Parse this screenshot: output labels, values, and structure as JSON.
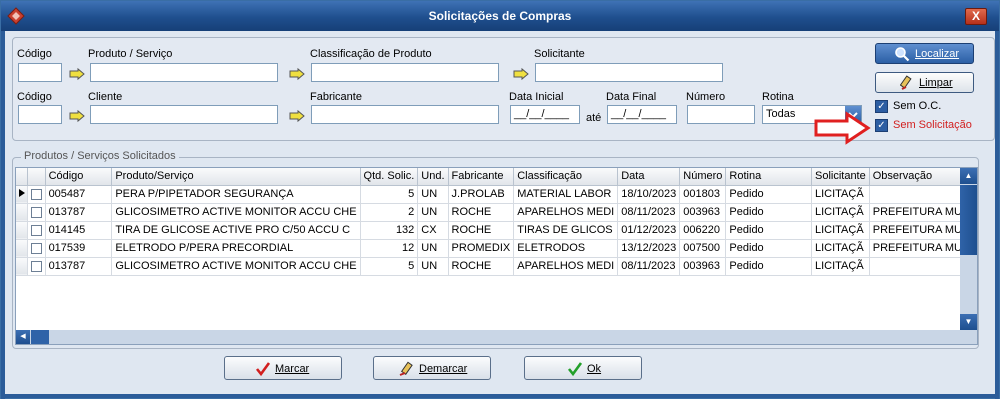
{
  "window": {
    "title": "Solicitações de Compras",
    "close_label": "X"
  },
  "filters": {
    "codigo1_label": "Código",
    "produto_label": "Produto / Serviço",
    "classificacao_label": "Classificação de Produto",
    "solicitante_label": "Solicitante",
    "codigo2_label": "Código",
    "cliente_label": "Cliente",
    "fabricante_label": "Fabricante",
    "data_inicial_label": "Data Inicial",
    "data_final_label": "Data Final",
    "ate_label": "até",
    "numero_label": "Número",
    "rotina_label": "Rotina",
    "data_inicial_value": "__/__/____",
    "data_final_value": "__/__/____",
    "rotina_value": "Todas",
    "localizar_label": "Localizar",
    "limpar_label": "Limpar",
    "sem_oc_label": "Sem O.C.",
    "sem_solicitacao_label": "Sem Solicitação",
    "sem_oc_checked": true,
    "sem_solicitacao_checked": true
  },
  "products": {
    "title": "Produtos / Serviços Solicitados",
    "columns": [
      "Código",
      "Produto/Serviço",
      "Qtd. Solic.",
      "Und.",
      "Fabricante",
      "Classificação",
      "Data",
      "Número",
      "Rotina",
      "Solicitante",
      "Observação"
    ],
    "rows": [
      [
        "005487",
        "PERA P/PIPETADOR SEGURANÇA",
        "5",
        "UN",
        "J.PROLAB",
        "MATERIAL LABOR",
        "18/10/2023",
        "001803",
        "Pedido",
        "LICITAÇÃ",
        ""
      ],
      [
        "013787",
        "GLICOSIMETRO ACTIVE MONITOR  ACCU CHE",
        "2",
        "UN",
        "ROCHE",
        "APARELHOS MEDI",
        "08/11/2023",
        "003963",
        "Pedido",
        "LICITAÇÃ",
        "PREFEITURA MUNI"
      ],
      [
        "014145",
        "TIRA DE GLICOSE ACTIVE PRO C/50  ACCU C",
        "132",
        "CX",
        "ROCHE",
        "TIRAS DE GLICOS",
        "01/12/2023",
        "006220",
        "Pedido",
        "LICITAÇÃ",
        "PREFEITURA MUNI"
      ],
      [
        "017539",
        "ELETRODO P/PERA PRECORDIAL",
        "12",
        "UN",
        "PROMEDIX",
        "ELETRODOS",
        "13/12/2023",
        "007500",
        "Pedido",
        "LICITAÇÃ",
        "PREFEITURA MUNI"
      ],
      [
        "013787",
        "GLICOSIMETRO ACTIVE MONITOR  ACCU CHE",
        "5",
        "UN",
        "ROCHE",
        "APARELHOS MEDI",
        "08/11/2023",
        "003963",
        "Pedido",
        "LICITAÇÃ",
        ""
      ]
    ]
  },
  "actions": {
    "marcar_label": "Marcar",
    "demarcar_label": "Demarcar",
    "ok_label": "Ok"
  },
  "colors": {
    "accent": "#2b5fa5",
    "highlight_red": "#e02020"
  }
}
